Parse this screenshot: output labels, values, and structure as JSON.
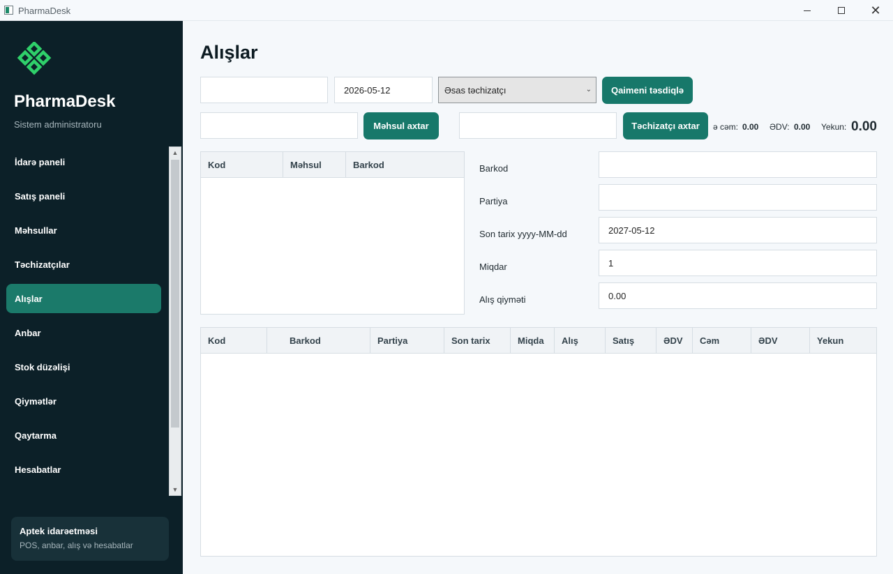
{
  "window": {
    "title": "PharmaDesk"
  },
  "sidebar": {
    "brand": "PharmaDesk",
    "role": "Sistem administratoru",
    "items": [
      {
        "label": "İdarə paneli"
      },
      {
        "label": "Satış paneli"
      },
      {
        "label": "Məhsullar"
      },
      {
        "label": "Təchizatçılar"
      },
      {
        "label": "Alışlar"
      },
      {
        "label": "Anbar"
      },
      {
        "label": "Stok düzəlişi"
      },
      {
        "label": "Qiymətlər"
      },
      {
        "label": "Qaytarma"
      },
      {
        "label": "Hesabatlar"
      }
    ],
    "active_index": 4,
    "footer": {
      "title": "Aptek idarəetməsi",
      "subtitle": "POS, anbar, alış və hesabatlar"
    }
  },
  "page": {
    "title": "Alışlar",
    "invoice_no": "",
    "date": "2026-05-12",
    "supplier_selected": "Əsas təchizatçı",
    "confirm_button": "Qaimeni təsdiqlə",
    "product_search": "",
    "product_search_button": "Məhsul axtar",
    "supplier_search": "",
    "supplier_search_button": "Təchizatçı axtar",
    "totals": {
      "sum_label": "ə cəm:",
      "sum_value": "0.00",
      "vat_label": "ƏDV:",
      "vat_value": "0.00",
      "total_label": "Yekun:",
      "total_value": "0.00"
    }
  },
  "product_table": {
    "columns": [
      "Kod",
      "Məhsul",
      "Barkod"
    ],
    "rows": []
  },
  "form": {
    "barcode_label": "Barkod",
    "barcode_value": "",
    "batch_label": "Partiya",
    "batch_value": "",
    "expiry_label": "Son tarix yyyy-MM-dd",
    "expiry_value": "2027-05-12",
    "qty_label": "Miqdar",
    "qty_value": "1",
    "price_label": "Alış qiyməti",
    "price_value": "0.00"
  },
  "items_table": {
    "columns": [
      "Kod",
      "Barkod",
      "Partiya",
      "Son tarix",
      "Miqda",
      "Alış",
      "Satış",
      "ƏDV",
      "Cəm",
      "ƏDV",
      "Yekun"
    ],
    "rows": []
  }
}
